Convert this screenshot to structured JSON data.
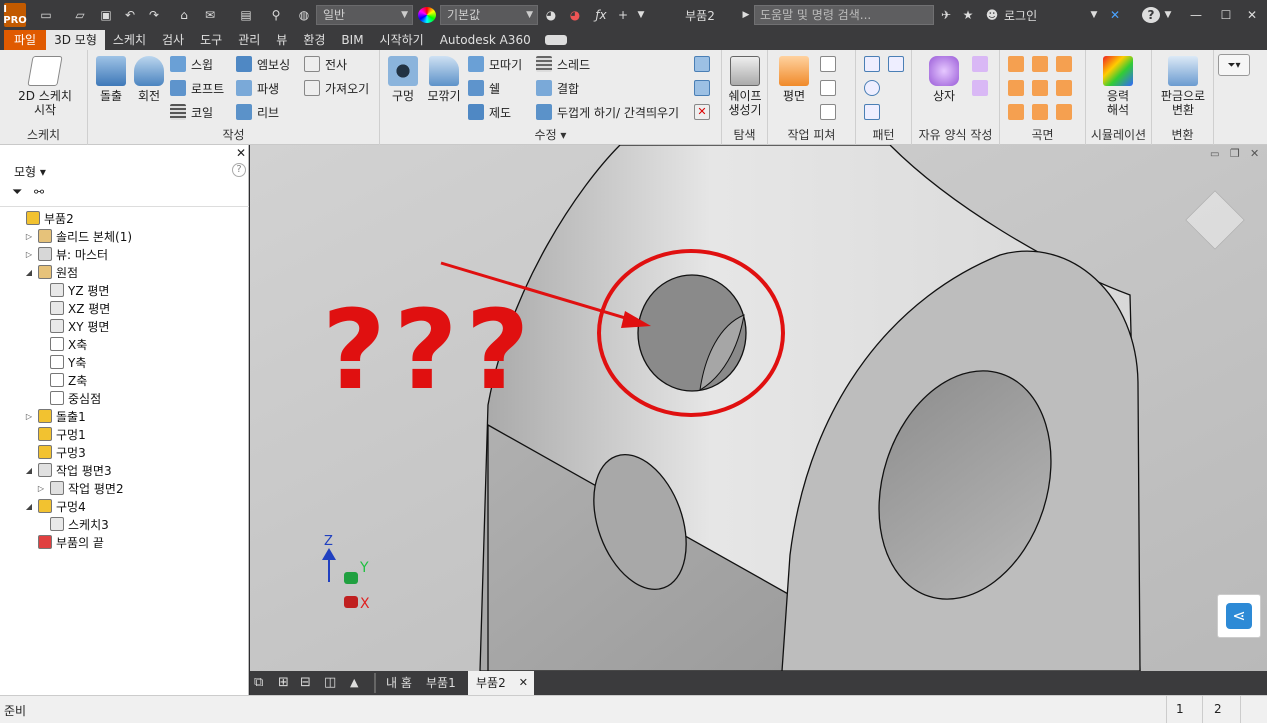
{
  "titlebar": {
    "app_logo": "I PRO",
    "style_combo": "일반",
    "material_combo": "기본값",
    "doc_title": "부품2",
    "search_placeholder": "도움말 및 명령 검색...",
    "login": "로그인",
    "icons": [
      "new-icon",
      "open-icon",
      "save-icon",
      "undo-icon",
      "redo-icon",
      "home-icon",
      "select-icon",
      "update-icon",
      "appearance-icon",
      "color-icon",
      "fx-icon",
      "crosshair-icon",
      "star-icon",
      "user-icon",
      "exchange-icon",
      "help-icon",
      "minimize-icon",
      "maximize-icon",
      "close-icon"
    ]
  },
  "tabs": [
    "파일",
    "3D 모형",
    "스케치",
    "검사",
    "도구",
    "관리",
    "뷰",
    "환경",
    "BIM",
    "시작하기",
    "Autodesk A360"
  ],
  "ribbon": {
    "sketch_group": {
      "title": "스케치",
      "start_label_1": "2D 스케치",
      "start_label_2": "시작"
    },
    "create_group": {
      "title": "작성",
      "extrude": "돌출",
      "revolve": "회전",
      "sweep": "스윕",
      "loft": "로프트",
      "coil": "코일",
      "emboss": "엠보싱",
      "derive": "파생",
      "rib": "리브",
      "decal": "전사",
      "import": "가져오기"
    },
    "modify_group": {
      "title": "수정 ▾",
      "hole": "구멍",
      "fillet": "모깎기",
      "chamfer": "모따기",
      "shell": "쉘",
      "draft": "제도",
      "thread": "스레드",
      "combine": "결합",
      "thicken": "두껍게 하기/ 간격띄우기"
    },
    "explore_group": {
      "title": "탐색",
      "shape_gen_1": "쉐이프",
      "shape_gen_2": "생성기"
    },
    "work_group": {
      "title": "작업 피쳐",
      "plane": "평면"
    },
    "pattern_group": {
      "title": "패턴"
    },
    "freeform_group": {
      "title": "자유 양식 작성",
      "box": "상자"
    },
    "surface_group": {
      "title": "곡면"
    },
    "sim_group": {
      "title": "시뮬레이션",
      "stress_1": "응력",
      "stress_2": "해석"
    },
    "convert_group": {
      "title": "변환",
      "sheet_1": "판금으로",
      "sheet_2": "변환"
    }
  },
  "panel": {
    "title": "모형 ▾",
    "help": "?",
    "tree": [
      {
        "label": "부품2",
        "indent": 0,
        "exp": "",
        "color": "#f2c230"
      },
      {
        "label": "솔리드 본체(1)",
        "indent": 1,
        "exp": "▷",
        "color": "#e6c27a"
      },
      {
        "label": "뷰: 마스터",
        "indent": 1,
        "exp": "▷",
        "color": "#d7d7d7"
      },
      {
        "label": "원점",
        "indent": 1,
        "exp": "◢",
        "color": "#e6c27a"
      },
      {
        "label": "YZ 평면",
        "indent": 2,
        "exp": "",
        "color": "#e8e8e8"
      },
      {
        "label": "XZ 평면",
        "indent": 2,
        "exp": "",
        "color": "#e8e8e8"
      },
      {
        "label": "XY 평면",
        "indent": 2,
        "exp": "",
        "color": "#e8e8e8"
      },
      {
        "label": "X축",
        "indent": 2,
        "exp": "",
        "color": "#ffffff"
      },
      {
        "label": "Y축",
        "indent": 2,
        "exp": "",
        "color": "#ffffff"
      },
      {
        "label": "Z축",
        "indent": 2,
        "exp": "",
        "color": "#ffffff"
      },
      {
        "label": "중심점",
        "indent": 2,
        "exp": "",
        "color": "#ffffff"
      },
      {
        "label": "돌출1",
        "indent": 1,
        "exp": "▷",
        "color": "#f2c230"
      },
      {
        "label": "구멍1",
        "indent": 1,
        "exp": "",
        "color": "#f2c230"
      },
      {
        "label": "구멍3",
        "indent": 1,
        "exp": "",
        "color": "#f2c230"
      },
      {
        "label": "작업 평면3",
        "indent": 1,
        "exp": "◢",
        "color": "#e0e0e0"
      },
      {
        "label": "작업 평면2",
        "indent": 2,
        "exp": "▷",
        "color": "#e0e0e0"
      },
      {
        "label": "구멍4",
        "indent": 1,
        "exp": "◢",
        "color": "#f2c230"
      },
      {
        "label": "스케치3",
        "indent": 2,
        "exp": "",
        "color": "#e8e8e8"
      },
      {
        "label": "부품의 끝",
        "indent": 1,
        "exp": "",
        "color": "#e04040"
      }
    ]
  },
  "viewport": {
    "annotation": "???",
    "triad_z": "Z",
    "triad_y": "Y",
    "triad_x": "X",
    "accent_red": "#e01010"
  },
  "doctabs": {
    "home": "내 홈",
    "tab1": "부품1",
    "tab2": "부품2",
    "close": "✕"
  },
  "status": {
    "left": "준비",
    "num1": "1",
    "num2": "2"
  }
}
